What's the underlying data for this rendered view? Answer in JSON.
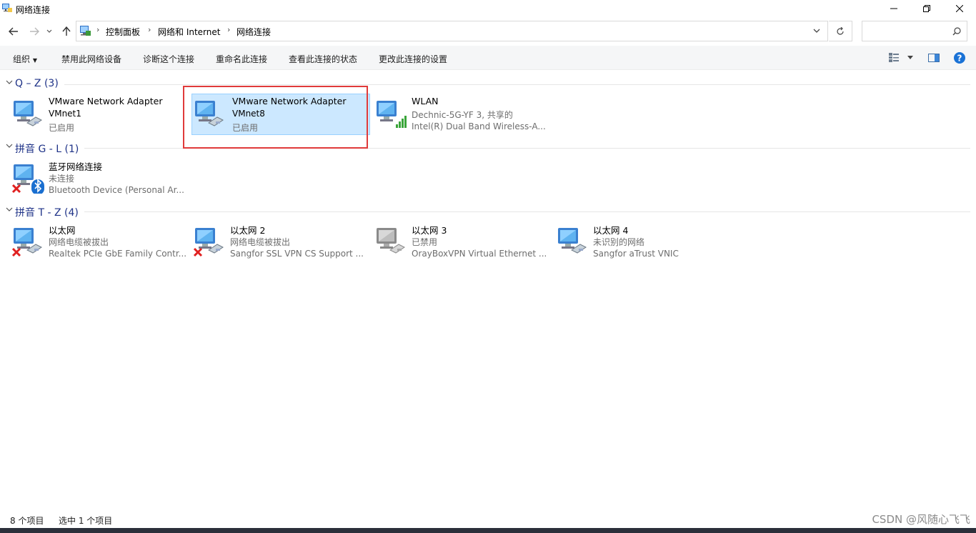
{
  "window": {
    "title": "网络连接"
  },
  "breadcrumb": [
    "控制面板",
    "网络和 Internet",
    "网络连接"
  ],
  "search": {
    "placeholder": ""
  },
  "toolbar": {
    "items": [
      "组织",
      "禁用此网络设备",
      "诊断这个连接",
      "重命名此连接",
      "查看此连接的状态",
      "更改此连接的设置"
    ]
  },
  "groups": [
    {
      "title": "Q – Z (3)"
    },
    {
      "title": "拼音 G - L (1)"
    },
    {
      "title": "拼音 T - Z (4)"
    }
  ],
  "items": [
    {
      "line1": "VMware Network Adapter",
      "line2": "VMnet1",
      "line3": "已启用",
      "icon": "network-adapter-icon"
    },
    {
      "line1": "VMware Network Adapter",
      "line2": "VMnet8",
      "line3": "已启用",
      "icon": "network-adapter-icon",
      "selected": true
    },
    {
      "line1": "WLAN",
      "line2": "Dechnic-5G-YF 3, 共享的",
      "line3": "Intel(R) Dual Band Wireless-A...",
      "icon": "wifi-adapter-icon"
    },
    {
      "line1": "蓝牙网络连接",
      "line2": "未连接",
      "line3": "Bluetooth Device (Personal Ar...",
      "icon": "bluetooth-adapter-icon",
      "status": "disconnected"
    },
    {
      "line1": "以太网",
      "line2": "网络电缆被拔出",
      "line3": "Realtek PCIe GbE Family Contr...",
      "icon": "ethernet-adapter-icon",
      "status": "disconnected"
    },
    {
      "line1": "以太网 2",
      "line2": "网络电缆被拔出",
      "line3": "Sangfor SSL VPN CS Support ...",
      "icon": "ethernet-adapter-icon",
      "status": "disconnected"
    },
    {
      "line1": "以太网 3",
      "line2": "已禁用",
      "line3": "OrayBoxVPN Virtual Ethernet ...",
      "icon": "ethernet-adapter-icon",
      "status": "disabled"
    },
    {
      "line1": "以太网 4",
      "line2": "未识别的网络",
      "line3": "Sangfor aTrust VNIC",
      "icon": "ethernet-adapter-icon"
    }
  ],
  "status": {
    "count": "8 个项目",
    "selected": "选中 1 个项目"
  },
  "watermark": "CSDN @风随心飞飞",
  "colors": {
    "selection_bg": "#cce8ff",
    "group_title": "#1e3287",
    "highlight_border": "#e03a3a"
  }
}
